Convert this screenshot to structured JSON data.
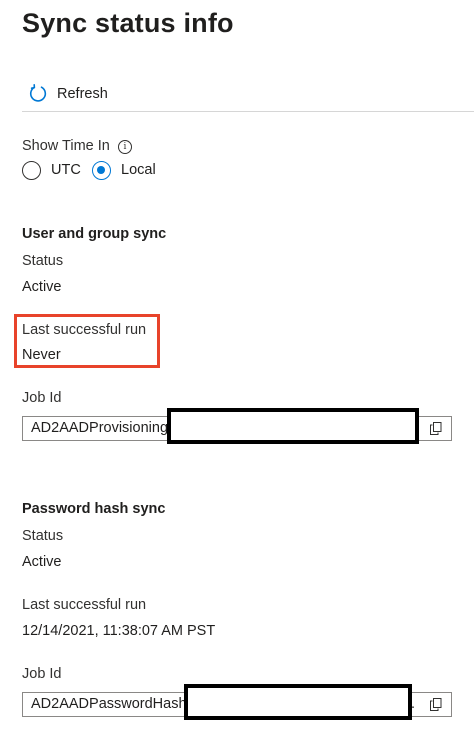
{
  "page": {
    "title": "Sync status info"
  },
  "toolbar": {
    "refresh_label": "Refresh",
    "refresh_icon": "refresh-icon"
  },
  "time_setting": {
    "label": "Show Time In",
    "info_icon": "info-icon",
    "info_glyph": "i",
    "options": [
      {
        "label": "UTC",
        "selected": false
      },
      {
        "label": "Local",
        "selected": true
      }
    ]
  },
  "user_group_sync": {
    "title": "User and group sync",
    "status_label": "Status",
    "status_value": "Active",
    "last_run_label": "Last successful run",
    "last_run_value": "Never",
    "job_id_label": "Job Id",
    "job_id_value": "AD2AADProvisioning",
    "highlight_color": "#e8432a"
  },
  "password_hash_sync": {
    "title": "Password hash sync",
    "status_label": "Status",
    "status_value": "Active",
    "last_run_label": "Last successful run",
    "last_run_value": "12/14/2021, 11:38:07 AM PST",
    "job_id_label": "Job Id",
    "job_id_value": "AD2AADPasswordHash.",
    "job_id_trailing": "."
  },
  "colors": {
    "accent": "#0078d4",
    "text": "#201f1e",
    "border": "#8a8886"
  }
}
